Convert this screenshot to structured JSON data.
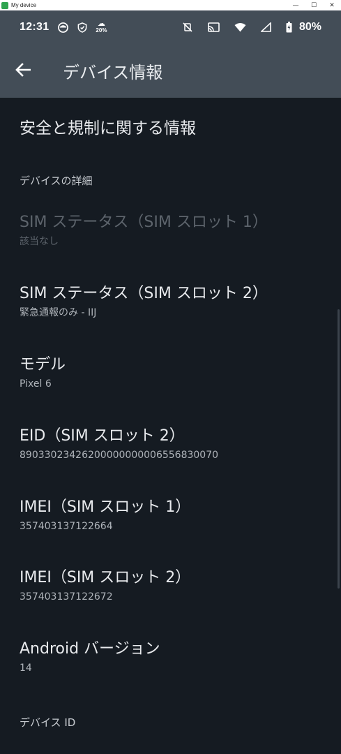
{
  "window": {
    "title": "My device",
    "controls": {
      "minimize": "—",
      "maximize": "☐",
      "close": "✕"
    }
  },
  "status_bar": {
    "time": "12:31",
    "weather_temp": "20%",
    "battery": "80%",
    "icons": [
      "face-icon",
      "shield-icon",
      "weather-icon",
      "vibrate-off-icon",
      "cast-icon",
      "wifi-icon",
      "signal-icon",
      "battery-icon"
    ]
  },
  "app_bar": {
    "title": "デバイス情報",
    "back_icon": "arrow-left-icon"
  },
  "list": {
    "safety_info": "安全と規制に関する情報",
    "section_device_details": "デバイスの詳細",
    "items": [
      {
        "title": "SIM ステータス（SIM スロット 1）",
        "summary": "該当なし",
        "disabled": true
      },
      {
        "title": "SIM ステータス（SIM スロット 2）",
        "summary": "緊急通報のみ - IIJ",
        "disabled": false
      },
      {
        "title": "モデル",
        "summary": "Pixel 6",
        "disabled": false
      },
      {
        "title": "EID（SIM スロット 2）",
        "summary": "89033023426200000000006556830070",
        "disabled": false
      },
      {
        "title": "IMEI（SIM スロット 1）",
        "summary": "357403137122664",
        "disabled": false
      },
      {
        "title": "IMEI（SIM スロット 2）",
        "summary": "357403137122672",
        "disabled": false
      },
      {
        "title": "Android バージョン",
        "summary": "14",
        "disabled": false
      }
    ],
    "section_device_id": "デバイス ID"
  }
}
